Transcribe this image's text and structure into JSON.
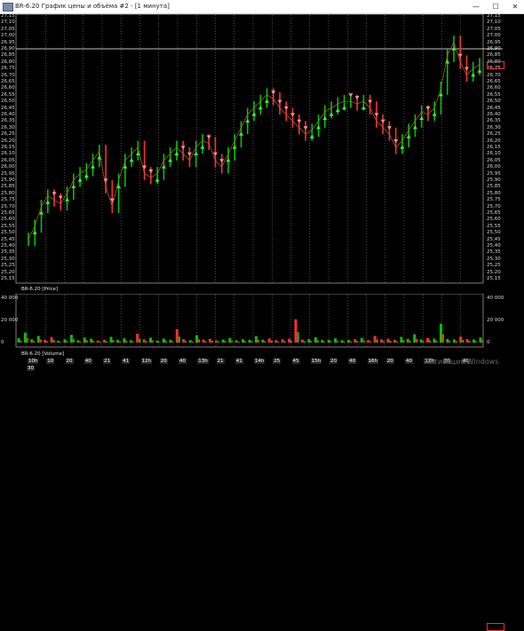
{
  "window": {
    "title": "BR-6.20 График цены и объёма #2 - [1 минута]",
    "minimize_glyph": "—",
    "maximize_glyph": "☐",
    "close_glyph": "✕"
  },
  "price_pane": {
    "label": "BR-6.20 [Price]",
    "y_ticks": [
      "27,15",
      "27,10",
      "27,05",
      "27,00",
      "26,95",
      "26,90",
      "26,85",
      "26,80",
      "26,75",
      "26,70",
      "26,65",
      "26,60",
      "26,55",
      "26,50",
      "26,45",
      "26,40",
      "26,35",
      "26,30",
      "26,25",
      "26,20",
      "26,15",
      "26,10",
      "26,05",
      "26,00",
      "25,95",
      "25,90",
      "25,85",
      "25,80",
      "25,75",
      "25,70",
      "25,65",
      "25,60",
      "25,55",
      "25,50",
      "25,45",
      "25,40",
      "25,35",
      "25,30",
      "25,25",
      "25,20",
      "25,15"
    ],
    "y_min": 25.15,
    "y_max": 27.15,
    "reference_line": 26.9,
    "colors": {
      "up": "#00c400",
      "down": "#ff3030",
      "buy_marker": "#33ff33",
      "sell_marker": "#ff8fa0",
      "grid": "#8a8a8a"
    }
  },
  "volume_pane": {
    "label": "BR-6.20 [Volume]",
    "y_ticks": [
      "40 000",
      "20 000",
      "0"
    ],
    "y_max": 40000
  },
  "time_axis": {
    "labels": [
      "10h",
      "10",
      "20",
      "40",
      "21",
      "41",
      "12h",
      "20",
      "40",
      "13h",
      "21",
      "41",
      "14h",
      "25",
      "45",
      "15h",
      "20",
      "40",
      "16h",
      "20",
      "40",
      "17h",
      "20",
      "40"
    ],
    "sub_label": "30"
  },
  "watermark": "Активация Windows",
  "chart_data": {
    "type": "line",
    "title": "BR-6.20",
    "xlabel": "",
    "ylabel": "",
    "ylim": [
      25.15,
      27.15
    ],
    "series": [
      {
        "name": "Price",
        "values": [
          25.45,
          25.55,
          25.7,
          25.78,
          25.75,
          25.72,
          25.8,
          25.9,
          25.95,
          25.98,
          26.05,
          26.12,
          25.85,
          25.7,
          25.9,
          26.05,
          26.1,
          26.15,
          25.95,
          25.92,
          25.95,
          26.05,
          26.1,
          26.15,
          26.1,
          26.05,
          26.15,
          26.2,
          26.18,
          26.05,
          26.0,
          26.1,
          26.2,
          26.3,
          26.4,
          26.45,
          26.5,
          26.55,
          26.52,
          26.45,
          26.4,
          26.35,
          26.3,
          26.25,
          26.28,
          26.35,
          26.42,
          26.45,
          26.48,
          26.5,
          26.5,
          26.48,
          26.5,
          26.45,
          26.35,
          26.3,
          26.25,
          26.15,
          26.2,
          26.28,
          26.35,
          26.42,
          26.4,
          26.45,
          26.6,
          26.85,
          26.95,
          26.8,
          26.7,
          26.75,
          26.78
        ]
      },
      {
        "name": "Volume",
        "values": [
          4000,
          9000,
          3000,
          6000,
          2500,
          5000,
          1500,
          3000,
          7000,
          2000,
          4500,
          3500,
          1800,
          2600,
          5200,
          2300,
          3900,
          2100,
          8000,
          2900,
          4400,
          1700,
          3600,
          2500,
          12000,
          3100,
          2200,
          6600,
          2700,
          3300,
          2000,
          2800,
          4100,
          1900,
          3000,
          2400,
          5800,
          2600,
          3700,
          2200,
          2900,
          3500,
          21000,
          2700,
          3100,
          4800,
          2300,
          2600,
          3800,
          2100,
          2500,
          3000,
          4200,
          2200,
          6000,
          2900,
          3500,
          2500,
          5200,
          3300,
          7500,
          2800,
          4100,
          3600,
          17000,
          3200,
          2900,
          5400,
          3100,
          2800,
          4600
        ]
      }
    ]
  }
}
